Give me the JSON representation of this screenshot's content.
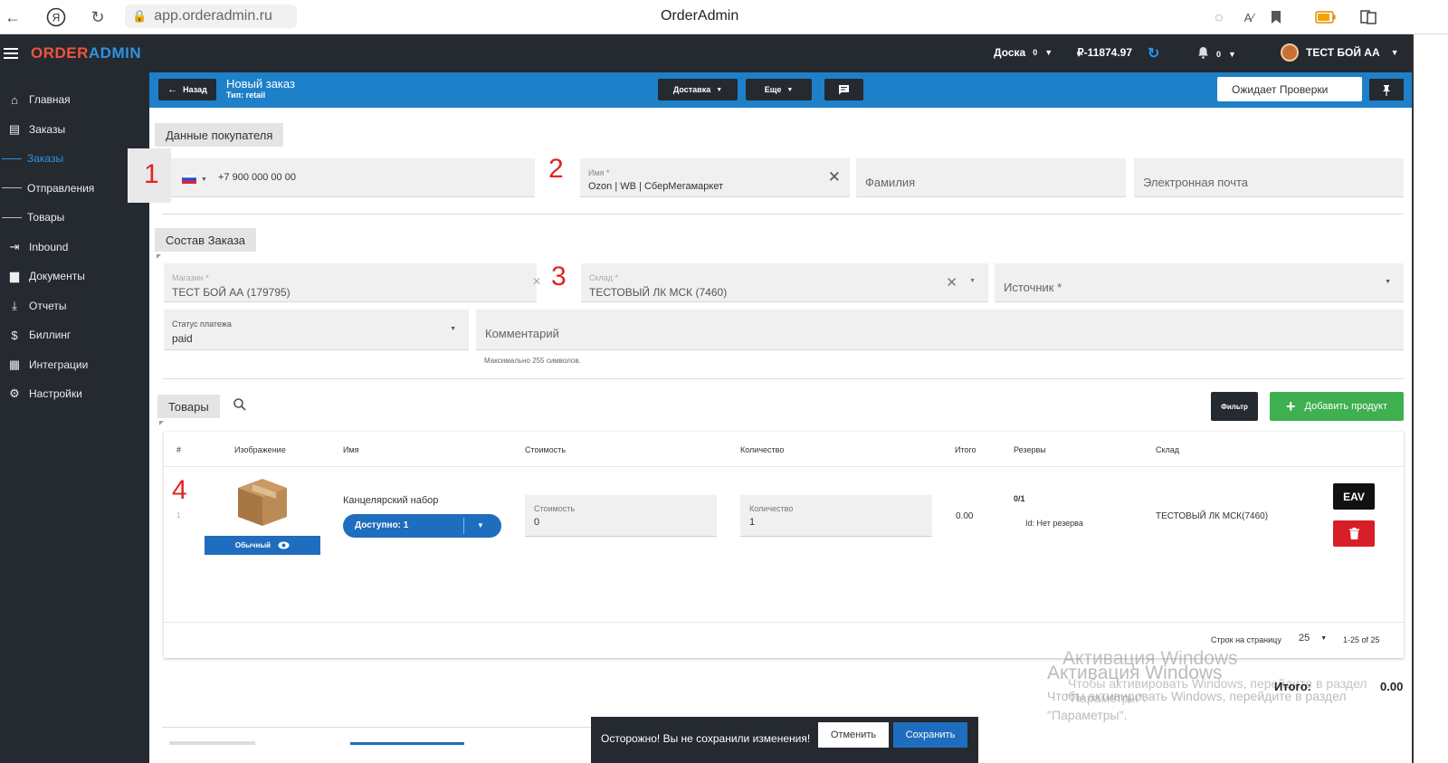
{
  "browser": {
    "url": "app.orderadmin.ru",
    "title": "OrderAdmin"
  },
  "logo": {
    "part1": "ORDER",
    "part2": "ADMIN"
  },
  "sidebar": {
    "items": [
      {
        "label": "Главная",
        "icon": "home-icon",
        "glyph": "⌂"
      },
      {
        "label": "Заказы",
        "icon": "store-icon",
        "glyph": "▤"
      },
      {
        "label": "Заказы",
        "sub": true,
        "active": true
      },
      {
        "label": "Отправления",
        "sub": true
      },
      {
        "label": "Товары",
        "sub": true
      },
      {
        "label": "Inbound",
        "icon": "inbound-icon",
        "glyph": "⇥"
      },
      {
        "label": "Документы",
        "icon": "document-icon",
        "glyph": "▆"
      },
      {
        "label": "Отчеты",
        "icon": "download-icon",
        "glyph": "⤓"
      },
      {
        "label": "Биллинг",
        "icon": "dollar-icon",
        "glyph": "$"
      },
      {
        "label": "Интеграции",
        "icon": "grid-icon",
        "glyph": "▦"
      },
      {
        "label": "Настройки",
        "icon": "gear-icon",
        "glyph": "⚙"
      }
    ]
  },
  "header": {
    "board_label": "Доска",
    "board_count": "0",
    "balance": "₽-11874.97",
    "notif_count": "0",
    "user_name": "ТЕСТ БОЙ АА"
  },
  "order_bar": {
    "back_label": "Назад",
    "title": "Новый заказ",
    "type": "Тип: retail",
    "delivery_label": "Доставка",
    "more_label": "Еще",
    "status": "Ожидает Проверки"
  },
  "customer": {
    "section_label": "Данные покупателя",
    "phone": "+7 900 000 00 00",
    "name_label": "Имя *",
    "name_value": "Ozon | WB | СберМегамаркет",
    "surname_placeholder": "Фамилия",
    "email_placeholder": "Электронная почта"
  },
  "order": {
    "section_label": "Состав Заказа",
    "shop_label": "Магазин *",
    "shop_value": "ТЕСТ БОЙ АА (179795)",
    "warehouse_label": "Склад *",
    "warehouse_value": "ТЕСТОВЫЙ ЛК МСК (7460)",
    "source_placeholder": "Источник *",
    "payment_label": "Статус платежа",
    "payment_value": "paid",
    "comment_placeholder": "Комментарий",
    "comment_hint": "Максимально 255 символов."
  },
  "products": {
    "section_label": "Товары",
    "filter_label": "Фильтр",
    "add_label": "Добавить продукт",
    "columns": [
      "#",
      "Изображение",
      "Имя",
      "Стоимость",
      "Количество",
      "Итого",
      "Резервы",
      "Склад"
    ],
    "row": {
      "index": "1",
      "type_label": "Обычный",
      "name": "Канцелярский набор",
      "available": "Доступно: 1",
      "price_label": "Стоимость",
      "price_value": "0",
      "qty_label": "Количество",
      "qty_value": "1",
      "total": "0.00",
      "reserve_count": "0/1",
      "reserve_info": "Id: Нет резерва",
      "warehouse": "ТЕСТОВЫЙ ЛК МСК(7460)",
      "eav_label": "EAV"
    },
    "per_page_label": "Строк на страницу",
    "per_page_value": "25",
    "range": "1-25 of 25"
  },
  "total": {
    "label": "Итого:",
    "value": "0.00"
  },
  "annotations": [
    "1",
    "2",
    "3",
    "4"
  ],
  "toast": {
    "message": "Осторожно! Вы не сохранили изменения!",
    "cancel_label": "Отменить",
    "save_label": "Сохранить"
  },
  "watermark": {
    "line1": "Активация Windows",
    "line2": "Чтобы активировать Windows, перейдите в раздел",
    "line3": "\"Параметры\"."
  }
}
